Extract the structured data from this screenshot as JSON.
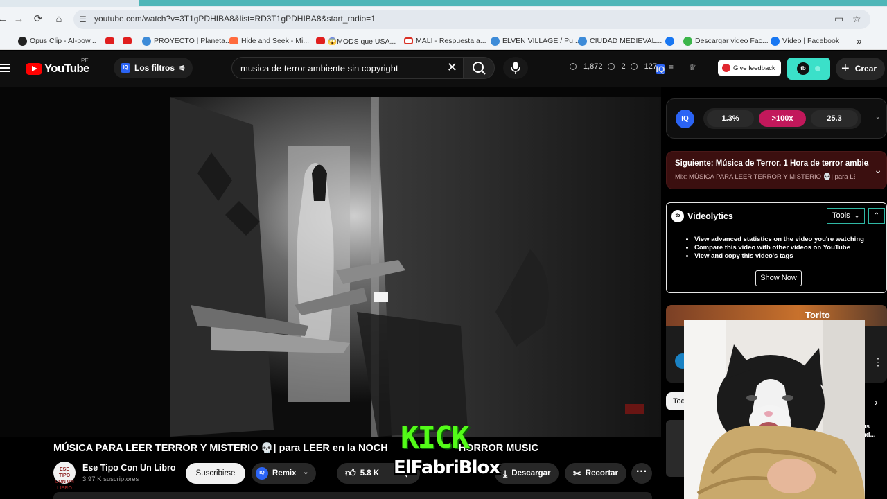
{
  "browser": {
    "url": "youtube.com/watch?v=3T1gPDHIBA8&list=RD3T1gPDHIBA8&start_radio=1",
    "bookmarks": [
      {
        "label": "Opus Clip - AI-pow...",
        "icon": "opus"
      },
      {
        "label": "",
        "icon": "yt"
      },
      {
        "label": "",
        "icon": "yt"
      },
      {
        "label": "PROYECTO | Planeta...",
        "icon": "globe"
      },
      {
        "label": "Hide and Seek - Mi...",
        "icon": "star"
      },
      {
        "label": "😱MODS que USA...",
        "icon": "yt"
      },
      {
        "label": "MALI - Respuesta a...",
        "icon": "gmail"
      },
      {
        "label": "ELVEN VILLAGE / Pu...",
        "icon": "globe"
      },
      {
        "label": "CIUDAD MEDIEVAL...",
        "icon": "globe"
      },
      {
        "label": "",
        "icon": "fb"
      },
      {
        "label": "Descargar video Fac...",
        "icon": "green"
      },
      {
        "label": "Vídeo | Facebook",
        "icon": "fb"
      }
    ],
    "more": "»"
  },
  "header": {
    "logo": "YouTube",
    "country": "PE",
    "filters_label": "Los filtros",
    "search_value": "musica de terror ambiente sin copyright",
    "stats": [
      "1,872",
      "2",
      "127"
    ],
    "feedback_label": "Give feedback",
    "create_label": "Crear"
  },
  "video": {
    "title": "MÚSICA PARA LEER TERROR Y MISTERIO 💀| para LEER en la NOCH",
    "title_end": "HORROR MUSIC",
    "channel_name": "Ese Tipo Con Un Libro",
    "channel_avatar_text": "ESE TIPO CON UN LIBRO",
    "subscribers": "3.97 K suscriptores",
    "subscribe_label": "Suscribirse",
    "remix_label": "Remix",
    "likes": "5.8 K",
    "download_label": "Descargar",
    "clip_label": "Recortar"
  },
  "overlay": {
    "kick": "KICK",
    "streamer": "ElFabriBlox"
  },
  "iq": {
    "values": [
      "1.3%",
      ">100x",
      "25.3"
    ],
    "accent": "#c2185b"
  },
  "next": {
    "title": "Siguiente: Música de Terror. 1 Hora de terror ambie...",
    "mix": "Mix: MÚSICA PARA LEER TERROR Y MISTERIO 💀| para LEE..."
  },
  "videolytics": {
    "name": "Videolytics",
    "tools_label": "Tools",
    "features": [
      "View advanced statistics on the video you're watching",
      "Compare this video with other videos on YouTube",
      "View and copy this video's tags"
    ],
    "button": "Show Now"
  },
  "recommended": {
    "thumb_text": "Torito",
    "chip": "Tod",
    "side_text": [
      "us",
      "nd..."
    ]
  }
}
